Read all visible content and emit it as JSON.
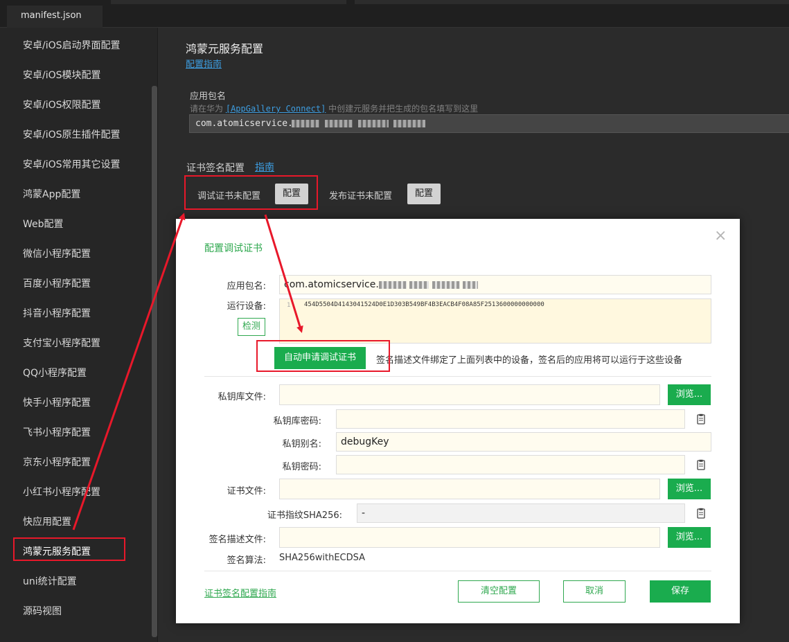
{
  "tab": {
    "label": "manifest.json"
  },
  "sidebar": {
    "items": [
      "安卓/iOS启动界面配置",
      "安卓/iOS模块配置",
      "安卓/iOS权限配置",
      "安卓/iOS原生插件配置",
      "安卓/iOS常用其它设置",
      "鸿蒙App配置",
      "Web配置",
      "微信小程序配置",
      "百度小程序配置",
      "抖音小程序配置",
      "支付宝小程序配置",
      "QQ小程序配置",
      "快手小程序配置",
      "飞书小程序配置",
      "京东小程序配置",
      "小红书小程序配置",
      "快应用配置",
      "鸿蒙元服务配置",
      "uni统计配置",
      "源码视图"
    ]
  },
  "main": {
    "title": "鸿蒙元服务配置",
    "guide_link": "配置指南",
    "package": {
      "label": "应用包名",
      "hint_prefix": "请在华为",
      "hint_link": "[AppGallery Connect]",
      "hint_suffix": "中创建元服务并把生成的包名填写到这里",
      "value": "com.atomicservice."
    },
    "cert": {
      "label": "证书签名配置",
      "guide": "指南",
      "debug_status": "调试证书未配置",
      "debug_button": "配置",
      "release_status": "发布证书未配置",
      "release_button": "配置"
    }
  },
  "dialog": {
    "title": "配置调试证书",
    "close": "×",
    "package_label": "应用包名:",
    "package_value": "com.atomicservice.",
    "device_label": "运行设备:",
    "device_line_no": "1",
    "device_id": "454D5504D4143041524D0E1D303B549BF4B3EACB4F08A85F2513600000000000",
    "detect_button": "检测",
    "auto_button": "自动申请调试证书",
    "auto_note": "签名描述文件绑定了上面列表中的设备，签名后的应用将可以运行于这些设备",
    "keystore_label": "私钥库文件:",
    "keystore_pwd_label": "私钥库密码:",
    "key_alias_label": "私钥别名:",
    "key_alias_value": "debugKey",
    "key_pwd_label": "私钥密码:",
    "cert_file_label": "证书文件:",
    "fingerprint_label": "证书指纹SHA256:",
    "fingerprint_value": "-",
    "profile_label": "签名描述文件:",
    "algo_label": "签名算法:",
    "algo_value": "SHA256withECDSA",
    "browse": "浏览...",
    "footer_link": "证书签名配置指南",
    "clear_button": "清空配置",
    "cancel_button": "取消",
    "save_button": "保存"
  },
  "colors": {
    "accent_green": "#1aac4e",
    "annotation_red": "#e8182a",
    "link_blue": "#3d9de0"
  }
}
